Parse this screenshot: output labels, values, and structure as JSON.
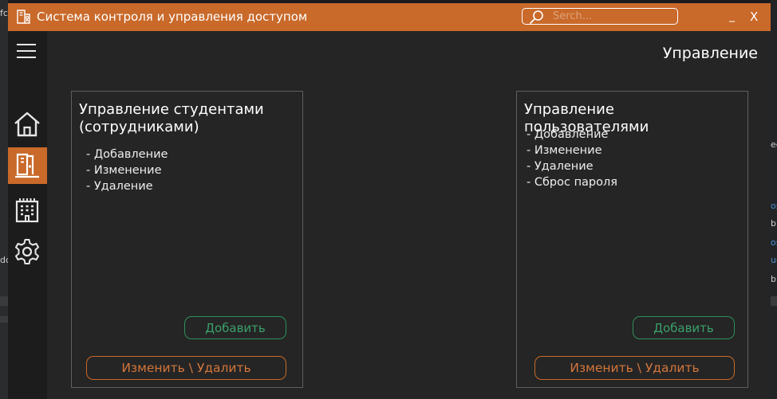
{
  "window": {
    "title": "Система контроля и управления доступом",
    "min_label": "_",
    "close_label": "X",
    "accent_color": "#c9692a",
    "success_color": "#3aa06a"
  },
  "search": {
    "placeholder": "Serch...",
    "value": ""
  },
  "sidebar": {
    "items": [
      {
        "icon": "home-icon",
        "active": false
      },
      {
        "icon": "access-control-icon",
        "active": true
      },
      {
        "icon": "building-icon",
        "active": false
      },
      {
        "icon": "settings-icon",
        "active": false
      }
    ]
  },
  "page": {
    "title": "Управление"
  },
  "cards": [
    {
      "title": "Управление студентами (сотрудниками)",
      "items": [
        "- Добавление",
        "- Изменение",
        "- Удаление"
      ],
      "add_label": "Добавить",
      "edit_label": "Изменить \\ Удалить"
    },
    {
      "title": "Управление пользователями",
      "items": [
        "- Добавление",
        "- Изменение",
        "- Удаление",
        "- Сброс пароля"
      ],
      "add_label": "Добавить",
      "edit_label": "Изменить \\ Удалить"
    }
  ],
  "background_fragments": {
    "left": [
      "fc",
      "dc"
    ],
    "right": [
      "ec",
      "os",
      "b",
      "os",
      "ug",
      "b"
    ]
  }
}
